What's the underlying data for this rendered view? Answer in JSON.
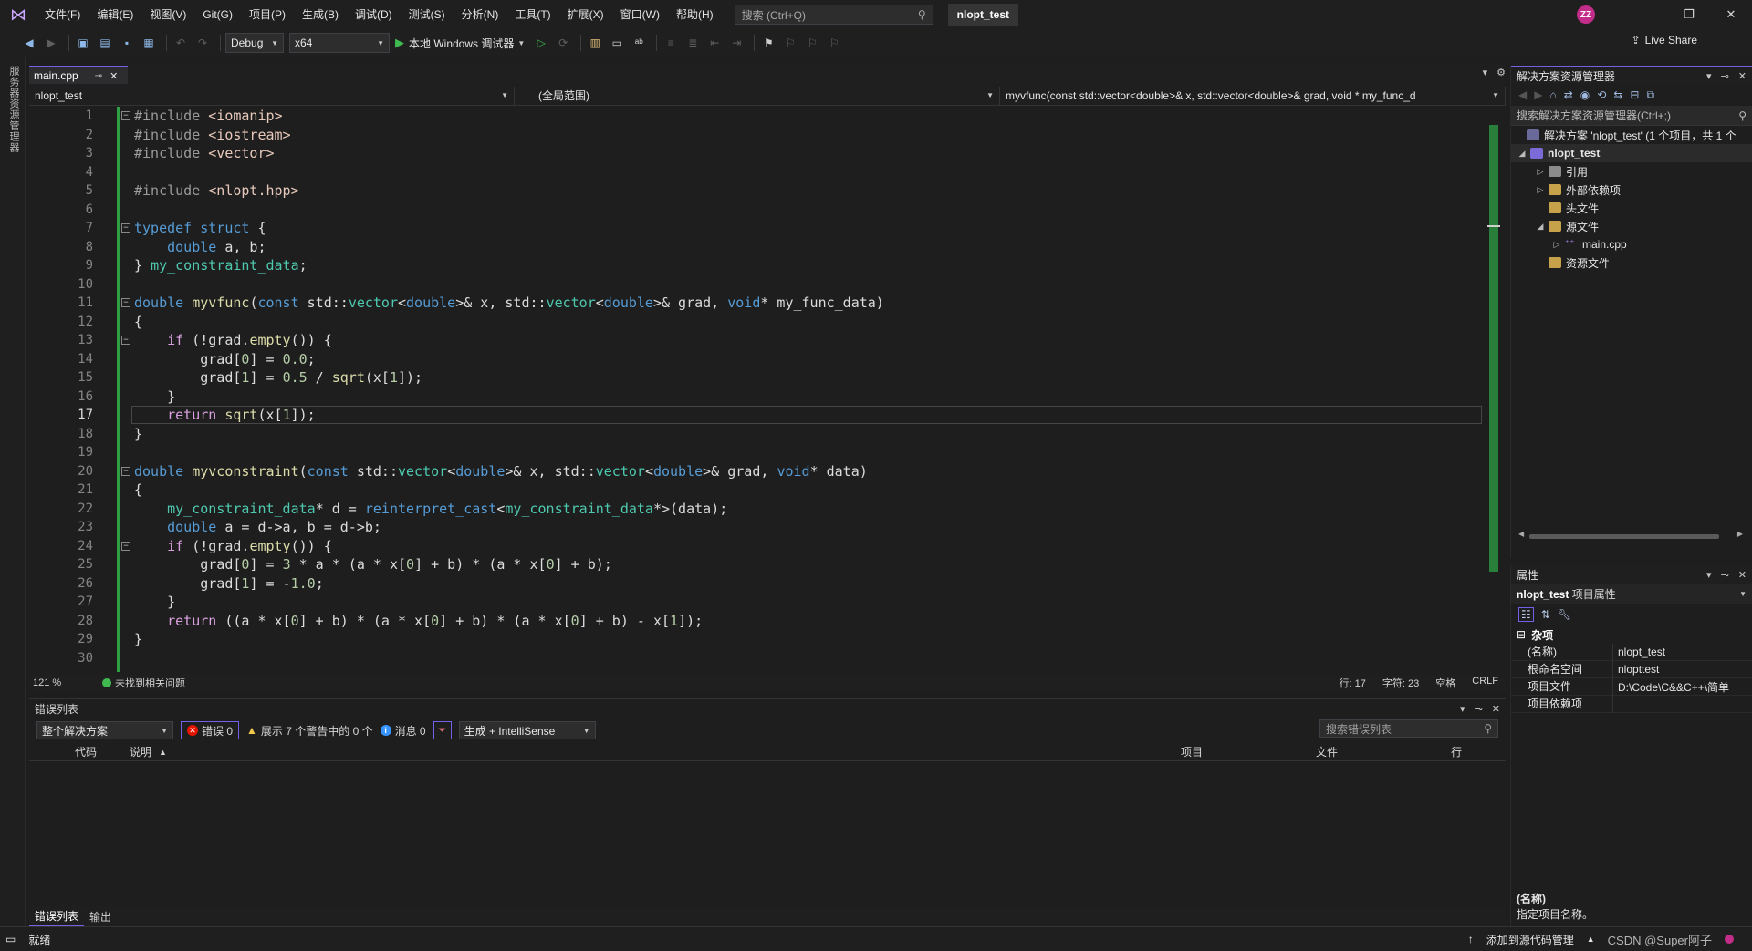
{
  "titlebar": {
    "menu": [
      "文件(F)",
      "编辑(E)",
      "视图(V)",
      "Git(G)",
      "项目(P)",
      "生成(B)",
      "调试(D)",
      "测试(S)",
      "分析(N)",
      "工具(T)",
      "扩展(X)",
      "窗口(W)",
      "帮助(H)"
    ],
    "search_placeholder": "搜索 (Ctrl+Q)",
    "solution_name": "nlopt_test",
    "avatar_initials": "ZZ",
    "accent_color": "#7160e8"
  },
  "toolbar": {
    "config": "Debug",
    "platform": "x64",
    "run_label": "本地 Windows 调试器",
    "live_share": "Live Share"
  },
  "left_strip": {
    "label": "服务器资源管理器"
  },
  "editor": {
    "tab_label": "main.cpp",
    "nav_project": "nlopt_test",
    "nav_scope": "(全局范围)",
    "nav_member": "myvfunc(const std::vector<double>& x, std::vector<double>& grad, void * my_func_d",
    "current_line": 17,
    "zoom": "121 %",
    "issues": "未找到相关问题",
    "caret_line": "行: 17",
    "caret_char": "字符: 23",
    "whitespace": "空格",
    "line_ending": "CRLF"
  },
  "code_lines": [
    {
      "n": "1",
      "t": "#include <iomanip>"
    },
    {
      "n": "2",
      "t": "#include <iostream>"
    },
    {
      "n": "3",
      "t": "#include <vector>"
    },
    {
      "n": "4",
      "t": ""
    },
    {
      "n": "5",
      "t": "#include <nlopt.hpp>"
    },
    {
      "n": "6",
      "t": ""
    },
    {
      "n": "7",
      "t": "typedef struct {"
    },
    {
      "n": "8",
      "t": "    double a, b;"
    },
    {
      "n": "9",
      "t": "} my_constraint_data;"
    },
    {
      "n": "10",
      "t": ""
    },
    {
      "n": "11",
      "t": "double myvfunc(const std::vector<double>& x, std::vector<double>& grad, void* my_func_data)"
    },
    {
      "n": "12",
      "t": "{"
    },
    {
      "n": "13",
      "t": "    if (!grad.empty()) {"
    },
    {
      "n": "14",
      "t": "        grad[0] = 0.0;"
    },
    {
      "n": "15",
      "t": "        grad[1] = 0.5 / sqrt(x[1]);"
    },
    {
      "n": "16",
      "t": "    }"
    },
    {
      "n": "17",
      "t": "    return sqrt(x[1]);"
    },
    {
      "n": "18",
      "t": "}"
    },
    {
      "n": "19",
      "t": ""
    },
    {
      "n": "20",
      "t": "double myvconstraint(const std::vector<double>& x, std::vector<double>& grad, void* data)"
    },
    {
      "n": "21",
      "t": "{"
    },
    {
      "n": "22",
      "t": "    my_constraint_data* d = reinterpret_cast<my_constraint_data*>(data);"
    },
    {
      "n": "23",
      "t": "    double a = d->a, b = d->b;"
    },
    {
      "n": "24",
      "t": "    if (!grad.empty()) {"
    },
    {
      "n": "25",
      "t": "        grad[0] = 3 * a * (a * x[0] + b) * (a * x[0] + b);"
    },
    {
      "n": "26",
      "t": "        grad[1] = -1.0;"
    },
    {
      "n": "27",
      "t": "    }"
    },
    {
      "n": "28",
      "t": "    return ((a * x[0] + b) * (a * x[0] + b) * (a * x[0] + b) - x[1]);"
    },
    {
      "n": "29",
      "t": "}"
    },
    {
      "n": "30",
      "t": ""
    }
  ],
  "error_list": {
    "title": "错误列表",
    "scope": "整个解决方案",
    "errors": "错误 0",
    "warnings": "展示 7 个警告中的 0 个",
    "messages": "消息 0",
    "build_filter": "生成 + IntelliSense",
    "search_placeholder": "搜索错误列表",
    "columns": [
      "代码",
      "说明",
      "项目",
      "文件",
      "行"
    ],
    "tabs": [
      "错误列表",
      "输出"
    ]
  },
  "solution_explorer": {
    "title": "解决方案资源管理器",
    "search_placeholder": "搜索解决方案资源管理器(Ctrl+;)",
    "solution_label": "解决方案 'nlopt_test' (1 个项目，共 1 个",
    "project": "nlopt_test",
    "nodes": [
      "引用",
      "外部依赖项",
      "头文件",
      "源文件",
      "main.cpp",
      "资源文件"
    ]
  },
  "properties": {
    "title": "属性",
    "object": "nlopt_test",
    "object_kind": "项目属性",
    "category": "杂项",
    "rows": [
      {
        "k": "(名称)",
        "v": "nlopt_test"
      },
      {
        "k": "根命名空间",
        "v": "nlopttest"
      },
      {
        "k": "项目文件",
        "v": "D:\\Code\\C&&C++\\简单"
      },
      {
        "k": "项目依赖项",
        "v": ""
      }
    ],
    "desc_title": "(名称)",
    "desc_text": "指定项目名称。"
  },
  "statusbar": {
    "ready": "就绪",
    "source_control": "添加到源代码管理",
    "watermark": "CSDN @Super阿子"
  }
}
